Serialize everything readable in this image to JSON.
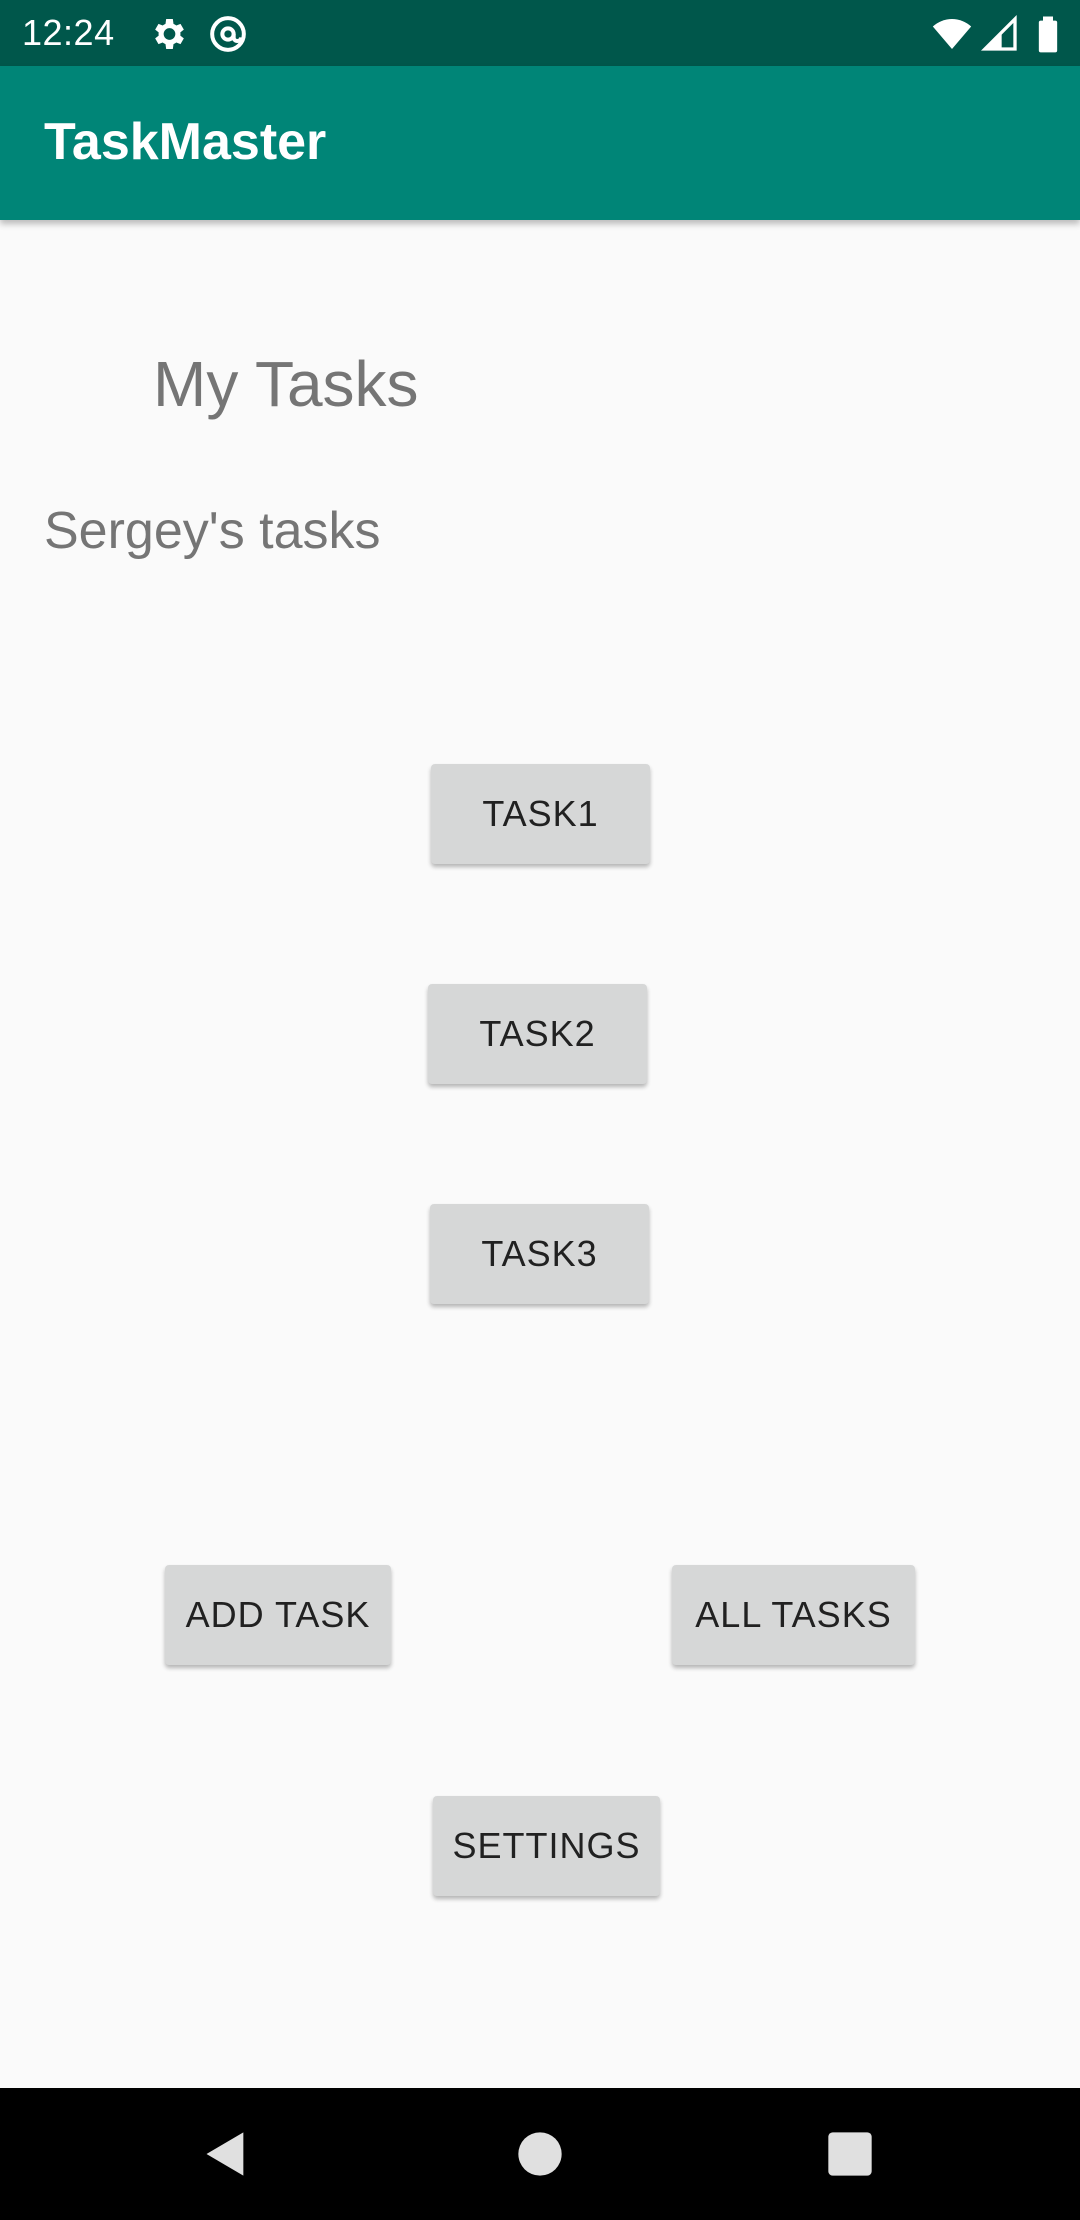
{
  "status_bar": {
    "time": "12:24",
    "icons": [
      "gear-icon",
      "at-sign-icon",
      "wifi-icon",
      "signal-icon",
      "battery-icon"
    ]
  },
  "app_bar": {
    "title": "TaskMaster"
  },
  "main": {
    "page_title": "My Tasks",
    "subtitle": "Sergey's tasks",
    "task_buttons": [
      "TASK1",
      "TASK2",
      "TASK3"
    ],
    "add_task_label": "ADD TASK",
    "all_tasks_label": "ALL TASKS",
    "settings_label": "SETTINGS"
  },
  "nav_bar": {
    "icons": [
      "back-icon",
      "home-icon",
      "recents-icon"
    ]
  },
  "colors": {
    "status_bar": "#00574b",
    "app_bar": "#008577",
    "background": "#fafafa",
    "button": "#d6d7d7",
    "muted_text": "#757575"
  }
}
